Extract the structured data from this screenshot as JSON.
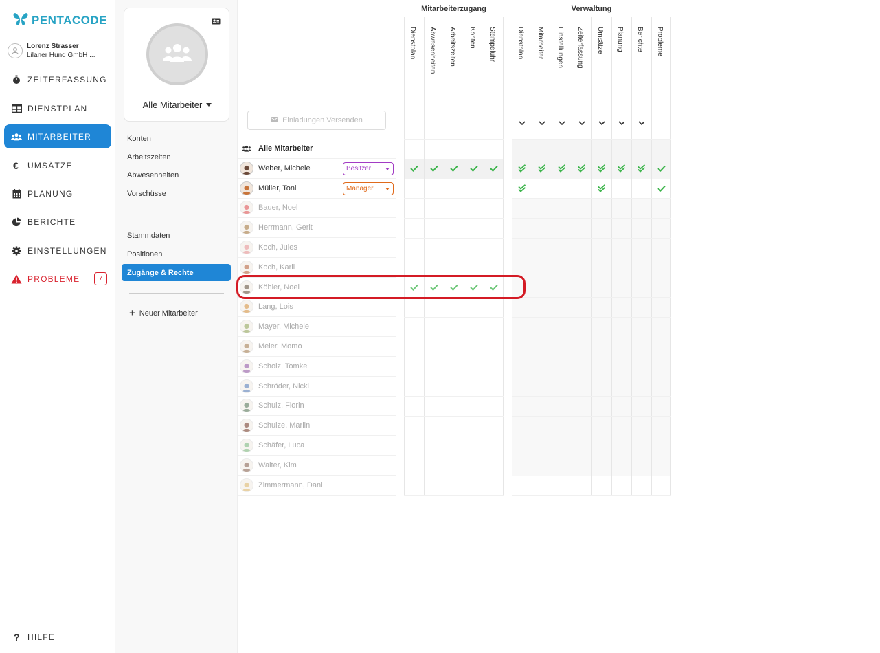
{
  "brand": {
    "name": "PENTACODE",
    "color": "#27a3c4"
  },
  "user": {
    "name": "Lorenz Strasser",
    "company": "Lilaner Hund GmbH ..."
  },
  "nav": [
    {
      "id": "zeiterfassung",
      "label": "ZEITERFASSUNG",
      "icon": "stopwatch-icon"
    },
    {
      "id": "dienstplan",
      "label": "DIENSTPLAN",
      "icon": "table-icon"
    },
    {
      "id": "mitarbeiter",
      "label": "MITARBEITER",
      "icon": "users-icon",
      "active": true
    },
    {
      "id": "umsaetze",
      "label": "UMSÄTZE",
      "icon": "euro-icon"
    },
    {
      "id": "planung",
      "label": "PLANUNG",
      "icon": "calendar-icon"
    },
    {
      "id": "berichte",
      "label": "BERICHTE",
      "icon": "pie-chart-icon"
    },
    {
      "id": "einstellungen",
      "label": "EINSTELLUNGEN",
      "icon": "gear-icon"
    },
    {
      "id": "probleme",
      "label": "PROBLEME",
      "icon": "warning-icon",
      "badge": "7"
    }
  ],
  "help": {
    "label": "HILFE"
  },
  "profile": {
    "selector_label": "Alle Mitarbeiter"
  },
  "submenu": {
    "group1": [
      "Konten",
      "Arbeitszeiten",
      "Abwesenheiten",
      "Vorschüsse"
    ],
    "group2": [
      "Stammdaten",
      "Positionen",
      "Zugänge & Rechte"
    ],
    "active": "Zugänge & Rechte",
    "new_employee": "Neuer Mitarbeiter"
  },
  "main": {
    "invite_button": "Einladungen Versenden",
    "all_label": "Alle Mitarbeiter",
    "groups": [
      {
        "title": "Mitarbeiterzugang",
        "columns": [
          "Dienstplan",
          "Abwesenheiten",
          "Arbeitszeiten",
          "Konten",
          "Stempeluhr"
        ]
      },
      {
        "title": "Verwaltung",
        "columns": [
          "Dienstplan",
          "Mitarbeiter",
          "Einstellungen",
          "Zeiterfassung",
          "Umsätze",
          "Planung",
          "Berichte",
          "Probleme"
        ]
      }
    ],
    "employees": [
      {
        "name": "Weber, Michele",
        "role": "Besitzer",
        "role_color": "#a23bc4",
        "active": true,
        "access": [
          1,
          1,
          1,
          1,
          1
        ],
        "admin": [
          2,
          2,
          2,
          2,
          2,
          2,
          2,
          1
        ],
        "avatar_color": "#6b4a3a"
      },
      {
        "name": "Müller, Toni",
        "role": "Manager",
        "role_color": "#e06a1b",
        "active": true,
        "access": [
          0,
          0,
          0,
          0,
          0
        ],
        "admin": [
          2,
          0,
          0,
          0,
          2,
          0,
          0,
          1
        ],
        "avatar_color": "#c8743a"
      },
      {
        "name": "Bauer, Noel",
        "active": false,
        "access": [
          0,
          0,
          0,
          0,
          0
        ],
        "admin": [
          0,
          0,
          0,
          0,
          0,
          0,
          0,
          0
        ],
        "avatar_color": "#e06a6a"
      },
      {
        "name": "Herrmann, Gerit",
        "active": false,
        "access": [
          0,
          0,
          0,
          0,
          0
        ],
        "admin": [
          0,
          0,
          0,
          0,
          0,
          0,
          0,
          0
        ],
        "avatar_color": "#b08a5a"
      },
      {
        "name": "Koch, Jules",
        "active": false,
        "access": [
          0,
          0,
          0,
          0,
          0
        ],
        "admin": [
          0,
          0,
          0,
          0,
          0,
          0,
          0,
          0
        ],
        "avatar_color": "#e8a0a0"
      },
      {
        "name": "Koch, Karli",
        "active": false,
        "access": [
          0,
          0,
          0,
          0,
          0
        ],
        "admin": [
          0,
          0,
          0,
          0,
          0,
          0,
          0,
          0
        ],
        "avatar_color": "#c07a5a"
      },
      {
        "name": "Köhler, Noel",
        "active": false,
        "access": [
          1,
          1,
          1,
          1,
          1
        ],
        "admin": [
          0,
          0,
          0,
          0,
          0,
          0,
          0,
          0
        ],
        "avatar_color": "#7a6a5a"
      },
      {
        "name": "Lang, Lois",
        "active": false,
        "access": [
          0,
          0,
          0,
          0,
          0
        ],
        "admin": [
          0,
          0,
          0,
          0,
          0,
          0,
          0,
          0
        ],
        "avatar_color": "#d9a05a"
      },
      {
        "name": "Mayer, Michele",
        "active": false,
        "access": [
          0,
          0,
          0,
          0,
          0
        ],
        "admin": [
          0,
          0,
          0,
          0,
          0,
          0,
          0,
          0
        ],
        "avatar_color": "#a0b070"
      },
      {
        "name": "Meier, Momo",
        "active": false,
        "access": [
          0,
          0,
          0,
          0,
          0
        ],
        "admin": [
          0,
          0,
          0,
          0,
          0,
          0,
          0,
          0
        ],
        "avatar_color": "#b0906a"
      },
      {
        "name": "Scholz, Tomke",
        "active": false,
        "access": [
          0,
          0,
          0,
          0,
          0
        ],
        "admin": [
          0,
          0,
          0,
          0,
          0,
          0,
          0,
          0
        ],
        "avatar_color": "#a070b0"
      },
      {
        "name": "Schröder, Nicki",
        "active": false,
        "access": [
          0,
          0,
          0,
          0,
          0
        ],
        "admin": [
          0,
          0,
          0,
          0,
          0,
          0,
          0,
          0
        ],
        "avatar_color": "#7090c0"
      },
      {
        "name": "Schulz, Florin",
        "active": false,
        "access": [
          0,
          0,
          0,
          0,
          0
        ],
        "admin": [
          0,
          0,
          0,
          0,
          0,
          0,
          0,
          0
        ],
        "avatar_color": "#708a70"
      },
      {
        "name": "Schulze, Marlin",
        "active": false,
        "access": [
          0,
          0,
          0,
          0,
          0
        ],
        "admin": [
          0,
          0,
          0,
          0,
          0,
          0,
          0,
          0
        ],
        "avatar_color": "#8a5a4a"
      },
      {
        "name": "Schäfer, Luca",
        "active": false,
        "access": [
          0,
          0,
          0,
          0,
          0
        ],
        "admin": [
          0,
          0,
          0,
          0,
          0,
          0,
          0,
          0
        ],
        "avatar_color": "#90c090"
      },
      {
        "name": "Walter, Kim",
        "active": false,
        "access": [
          0,
          0,
          0,
          0,
          0
        ],
        "admin": [
          0,
          0,
          0,
          0,
          0,
          0,
          0,
          0
        ],
        "avatar_color": "#9a7a6a"
      },
      {
        "name": "Zimmermann, Dani",
        "active": false,
        "access": [
          0,
          0,
          0,
          0,
          0
        ],
        "admin": [
          0,
          0,
          0,
          0,
          0,
          0,
          0,
          0
        ],
        "avatar_color": "#e0c080"
      }
    ]
  },
  "colors": {
    "accent": "#1f86d6",
    "check": "#3cb44b",
    "danger": "#d9232f",
    "highlight": "#d41b25"
  }
}
